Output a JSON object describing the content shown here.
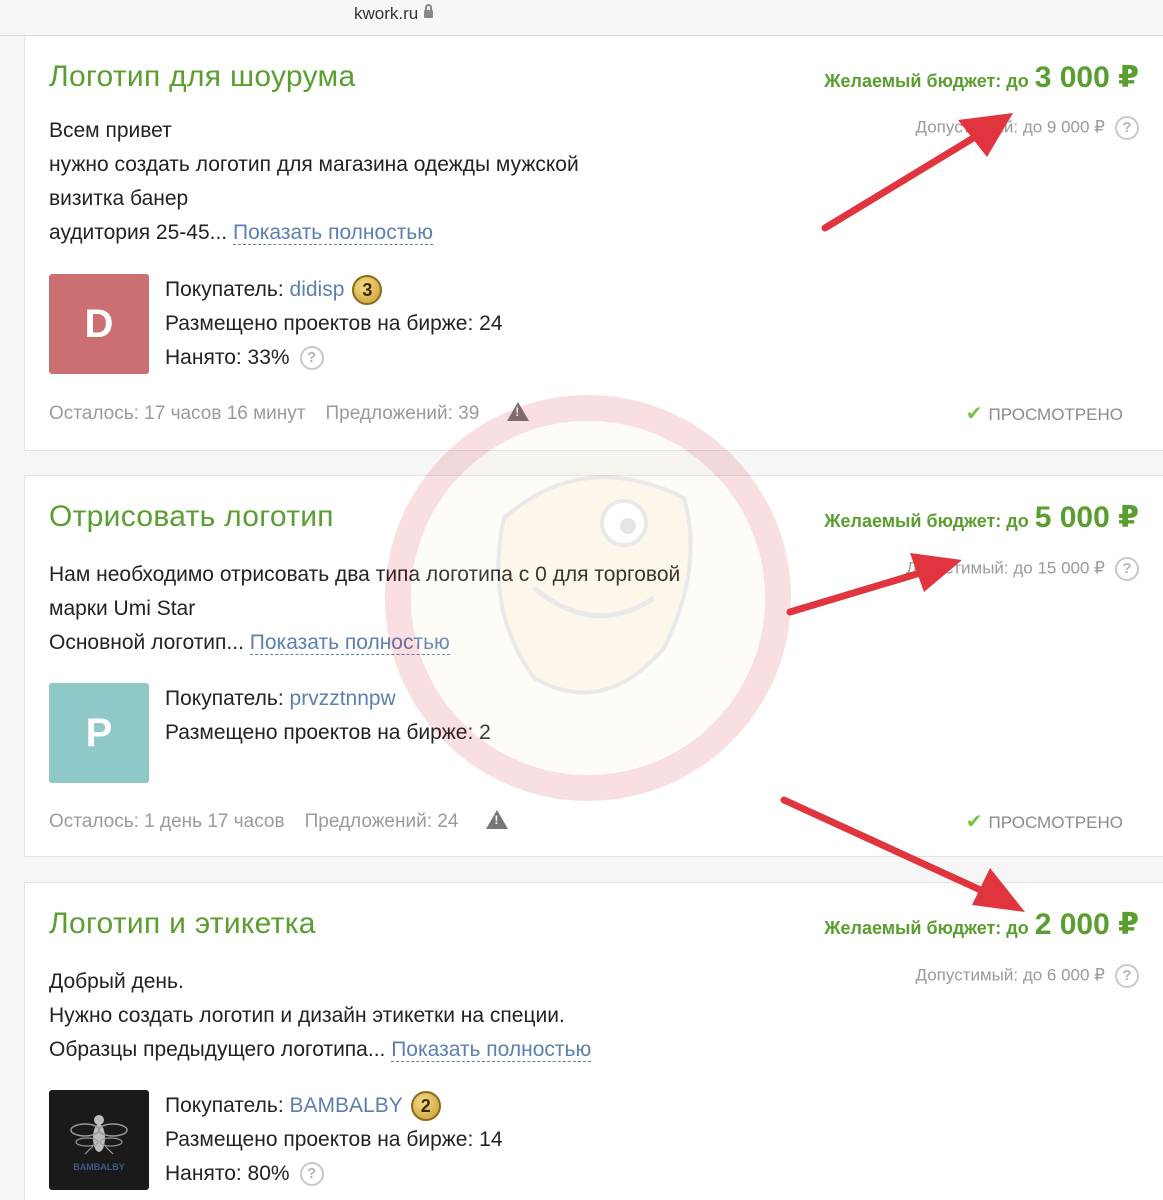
{
  "browser": {
    "url": "kwork.ru"
  },
  "projects": [
    {
      "title": "Логотип для шоурума",
      "budget_label": "Желаемый бюджет: до",
      "budget_amount": "3 000 ₽",
      "allowed": "Допустимый: до 9 000 ₽",
      "desc_lines": [
        "Всем привет",
        "нужно создать логотип для магазина одежды мужской",
        "визитка банер"
      ],
      "desc_last": "аудитория 25-45... ",
      "show_more": "Показать полностью",
      "avatar_letter": "D",
      "avatar_color": "#cc6f72",
      "buyer_label": "Покупатель: ",
      "buyer_name": "didisp",
      "badge": "3",
      "projects_placed": "Размещено проектов на бирже: 24",
      "hired": "Нанято: 33%",
      "time_left": "Осталось: 17 часов 16 минут",
      "offers": "Предложений: 39",
      "viewed": "ПРОСМОТРЕНО"
    },
    {
      "title": "Отрисовать логотип",
      "budget_label": "Желаемый бюджет: до",
      "budget_amount": "5 000 ₽",
      "allowed": "Допустимый: до 15 000 ₽",
      "desc_lines": [
        "Нам необходимо отрисовать два типа логотипа с 0 для торговой",
        "марки Umi Star"
      ],
      "desc_last": "Основной логотип... ",
      "show_more": "Показать полностью",
      "avatar_letter": "P",
      "avatar_color": "#8fc8c8",
      "buyer_label": "Покупатель: ",
      "buyer_name": "prvzztnnpw",
      "projects_placed": "Размещено проектов на бирже: 2",
      "time_left": "Осталось: 1 день 17 часов",
      "offers": "Предложений: 24",
      "viewed": "ПРОСМОТРЕНО"
    },
    {
      "title": "Логотип и этикетка",
      "budget_label": "Желаемый бюджет: до",
      "budget_amount": "2 000 ₽",
      "allowed": "Допустимый: до 6 000 ₽",
      "desc_lines": [
        "Добрый день.",
        "Нужно создать логотип и дизайн этикетки на специи."
      ],
      "desc_last": "Образцы предыдущего логотипа... ",
      "show_more": "Показать полностью",
      "avatar_text": "BAMBALBY",
      "buyer_label": "Покупатель: ",
      "buyer_name": "BAMBALBY",
      "badge": "2",
      "projects_placed": "Размещено проектов на бирже: 14",
      "hired": "Нанято: 80%"
    }
  ],
  "colors": {
    "title_green": "#5a9e2f",
    "link_blue": "#5c7fb0",
    "arrow_red": "#e0343f"
  }
}
